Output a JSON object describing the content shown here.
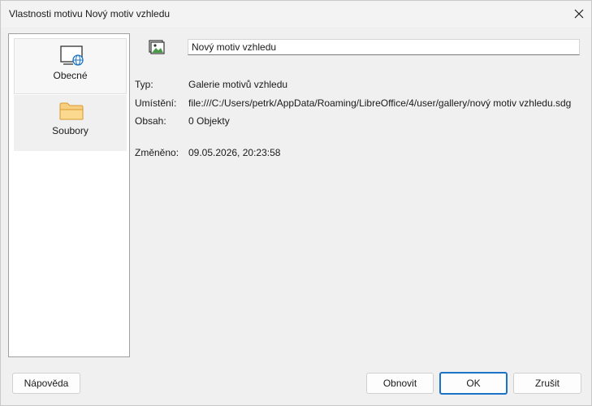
{
  "window": {
    "title": "Vlastnosti motivu Nový motiv vzhledu"
  },
  "sidebar": {
    "items": [
      {
        "label": "Obecné",
        "icon": "monitor-globe-icon",
        "active": true
      },
      {
        "label": "Soubory",
        "icon": "folder-icon",
        "active": false
      }
    ]
  },
  "general": {
    "name_value": "Nový motiv vzhledu",
    "type_label": "Typ:",
    "type_value": "Galerie motivů vzhledu",
    "location_label": "Umístění:",
    "location_value": "file:///C:/Users/petrk/AppData/Roaming/LibreOffice/4/user/gallery/nový motiv vzhledu.sdg",
    "content_label": "Obsah:",
    "content_value": "0 Objekty",
    "modified_label": "Změněno:",
    "modified_value": "09.05.2026, 20:23:58"
  },
  "buttons": {
    "help": "Nápověda",
    "reset": "Obnovit",
    "ok": "OK",
    "cancel": "Zrušit"
  },
  "colors": {
    "accent": "#1a73c8",
    "folder": "#f5c26b"
  }
}
